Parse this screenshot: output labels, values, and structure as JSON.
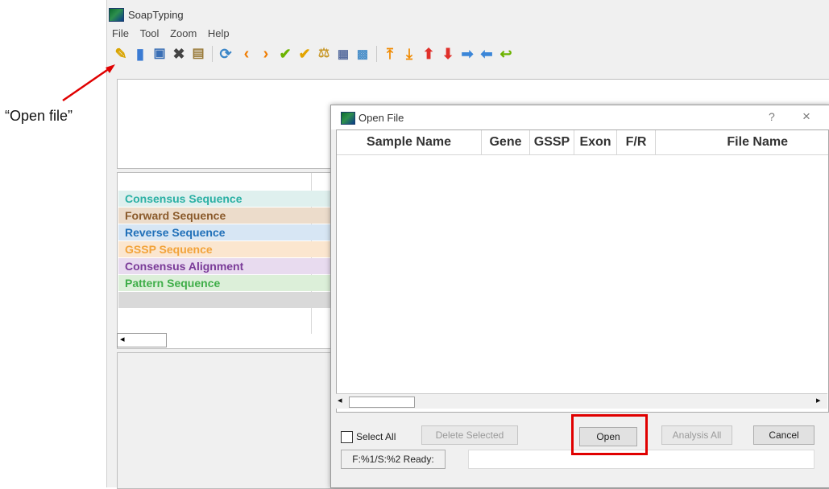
{
  "app": {
    "title": "SoapTyping",
    "menu": [
      "File",
      "Tool",
      "Zoom",
      "Help"
    ]
  },
  "annotation": {
    "open_file_label": "“Open file”"
  },
  "sequences": [
    {
      "label": "Consensus Sequence",
      "color": "#2ab0a4",
      "bg": "#dff0ee"
    },
    {
      "label": "Forward Sequence",
      "color": "#8a5a2b",
      "bg": "#ecdccb"
    },
    {
      "label": "Reverse Sequence",
      "color": "#1f6fb8",
      "bg": "#d7e6f4"
    },
    {
      "label": "GSSP Sequence",
      "color": "#f2a33a",
      "bg": "#fbe6cf"
    },
    {
      "label": "Consensus Alignment",
      "color": "#7a3b98",
      "bg": "#e8dbef"
    },
    {
      "label": "Pattern Sequence",
      "color": "#3fae49",
      "bg": "#dcefd9"
    }
  ],
  "dialog": {
    "title": "Open File",
    "help": "?",
    "close": "×",
    "columns": [
      "Sample Name",
      "Gene",
      "GSSP",
      "Exon",
      "F/R",
      "File Name"
    ],
    "select_all": "Select All",
    "delete_selected": "Delete Selected",
    "open": "Open",
    "analysis_all": "Analysis All",
    "cancel": "Cancel",
    "status": "F:%1/S:%2 Ready:"
  },
  "colors": {
    "annotation_red": "#e00000"
  }
}
